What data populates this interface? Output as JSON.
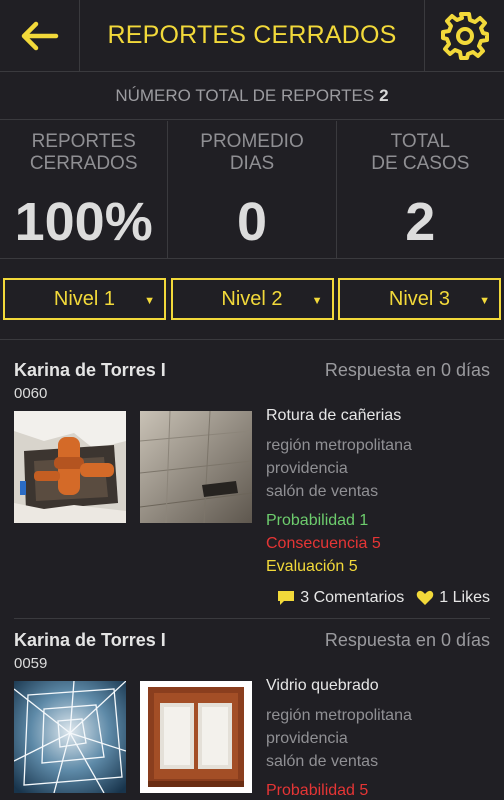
{
  "header": {
    "title": "REPORTES CERRADOS",
    "back_icon": "arrow-left-icon",
    "settings_icon": "gear-icon",
    "accent_color": "#f2d93a"
  },
  "total": {
    "label": "NÚMERO TOTAL DE REPORTES",
    "value": "2"
  },
  "stats": [
    {
      "label": "REPORTES\nCERRADOS",
      "value": "100%"
    },
    {
      "label": "PROMEDIO\nDIAS",
      "value": "0"
    },
    {
      "label": "TOTAL\nDE CASOS",
      "value": "2"
    }
  ],
  "levels": [
    {
      "label": "Nivel 1"
    },
    {
      "label": "Nivel 2"
    },
    {
      "label": "Nivel 3"
    }
  ],
  "reports": [
    {
      "name": "Karina de Torres I",
      "response": "Respuesta en 0 días",
      "code": "0060",
      "title": "Rotura de cañerias",
      "region": "región metropolitana",
      "commune": "providencia",
      "place": "salón de ventas",
      "probabilidad": "Probabilidad 1",
      "consecuencia": "Consecuencia 5",
      "evaluacion": "Evaluación 5",
      "comments": "3 Comentarios",
      "likes": "1 Likes"
    },
    {
      "name": "Karina de Torres I",
      "response": "Respuesta en 0 días",
      "code": "0059",
      "title": "Vidrio quebrado",
      "region": "región metropolitana",
      "commune": "providencia",
      "place": "salón de ventas",
      "probabilidad": "Probabilidad 5"
    }
  ]
}
